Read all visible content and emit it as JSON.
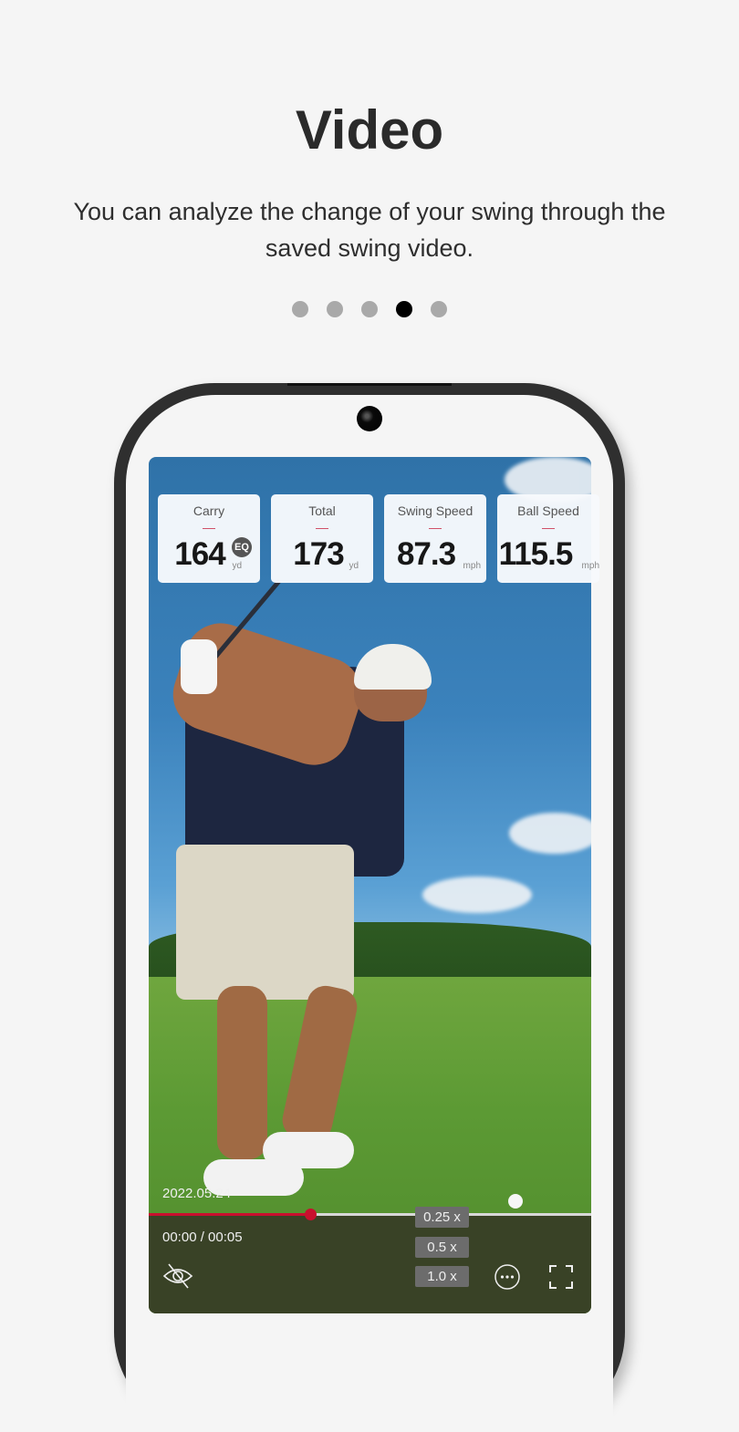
{
  "header": {
    "title": "Video",
    "subtitle": "You can analyze the change of your swing through the saved swing video."
  },
  "pagination": {
    "total": 5,
    "active_index": 3
  },
  "stats": [
    {
      "label": "Carry",
      "value": "164",
      "unit": "yd",
      "badge": "EQ"
    },
    {
      "label": "Total",
      "value": "173",
      "unit": "yd"
    },
    {
      "label": "Swing Speed",
      "value": "87.3",
      "unit": "mph"
    },
    {
      "label": "Ball Speed",
      "value": "115.5",
      "unit": "mph"
    }
  ],
  "player": {
    "date": "2022.05.24",
    "time": "00:00 / 00:05",
    "progress_fraction": 0.365,
    "speed_options": [
      "0.25 x",
      "0.5 x",
      "1.0 x"
    ],
    "icons": {
      "visibility": "eye-off-icon",
      "more": "more-horizontal-icon",
      "fullscreen": "fullscreen-icon"
    },
    "accent_color": "#c8102e"
  }
}
